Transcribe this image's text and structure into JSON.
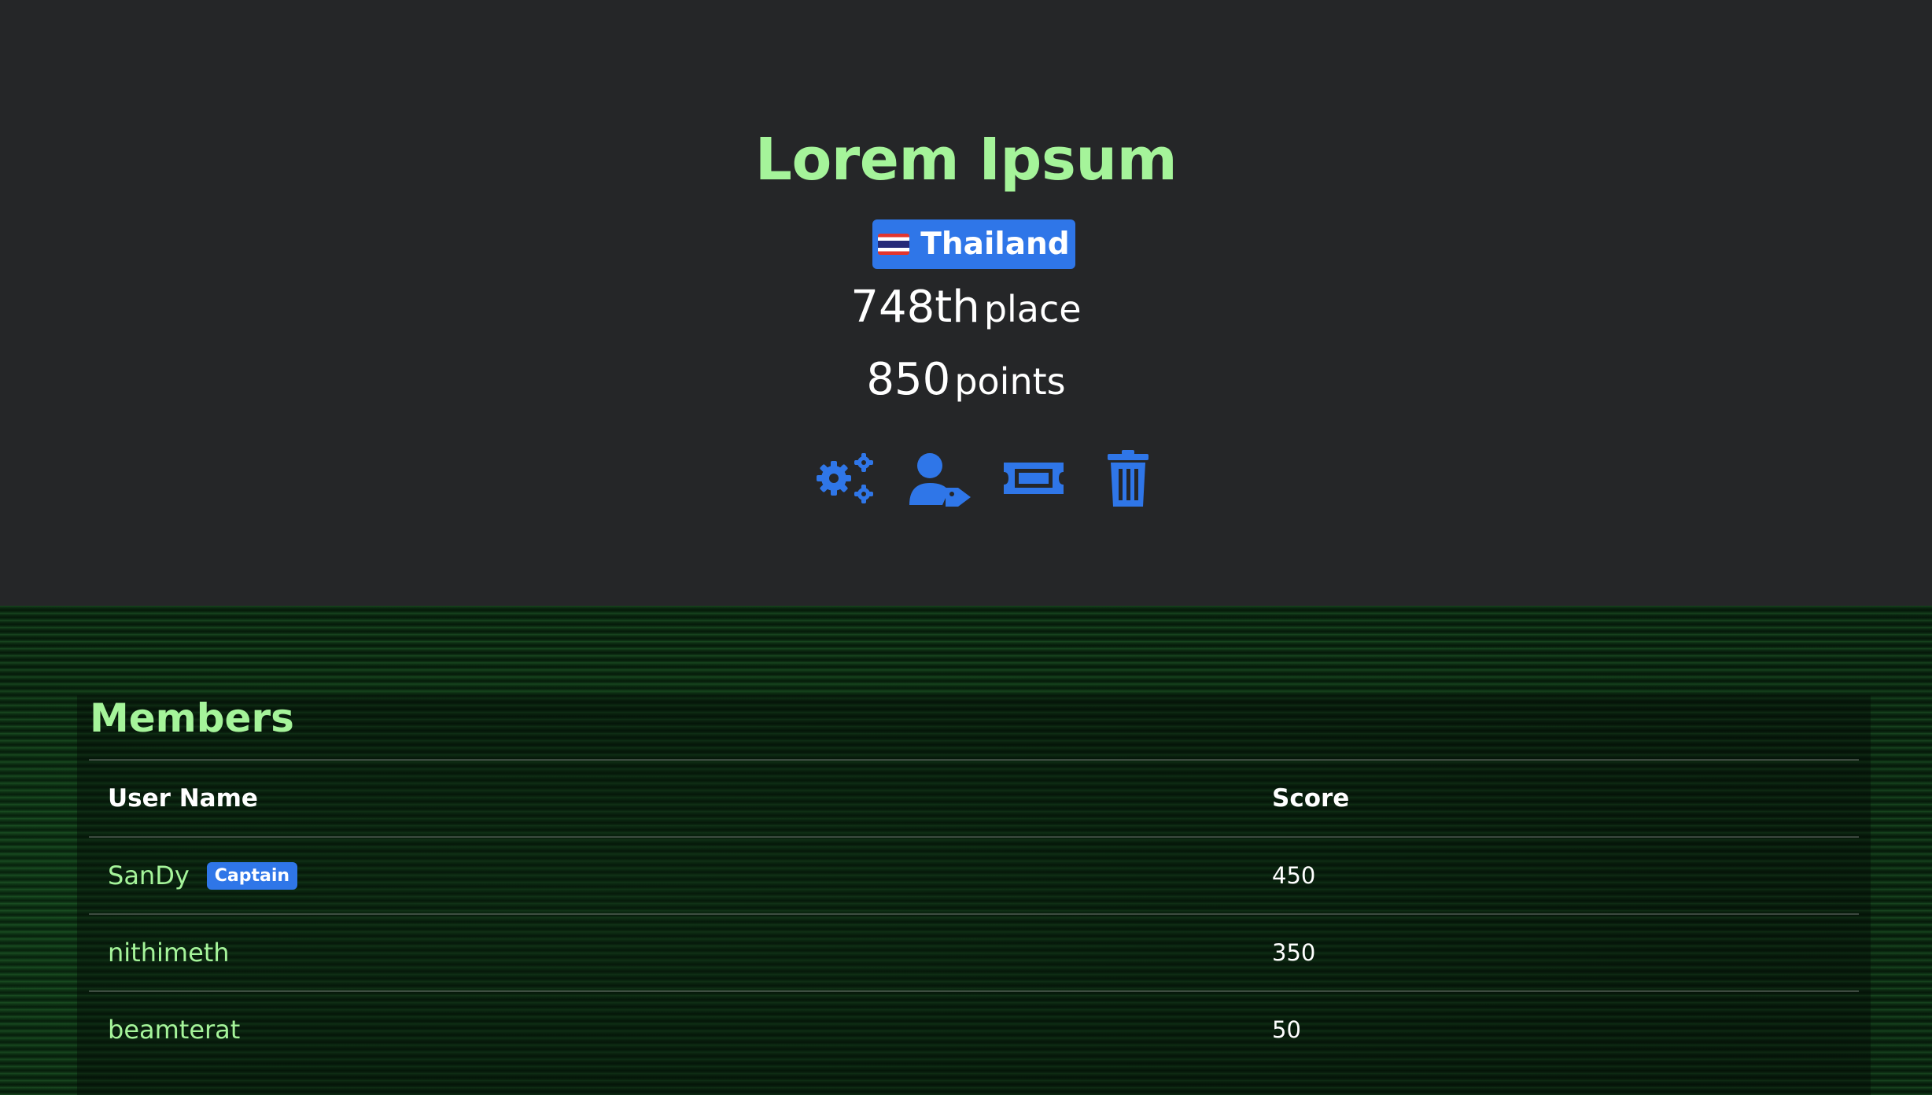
{
  "team": {
    "name": "Lorem Ipsum",
    "country": "Thailand",
    "place_number": "748th",
    "place_label": "place",
    "points_number": "850",
    "points_label": "points"
  },
  "actions": [
    {
      "icon": "gears-icon"
    },
    {
      "icon": "user-tag-icon"
    },
    {
      "icon": "ticket-icon"
    },
    {
      "icon": "trash-icon"
    }
  ],
  "members": {
    "title": "Members",
    "columns": [
      "User Name",
      "Score"
    ],
    "rows": [
      {
        "name": "SanDy",
        "badge": "Captain",
        "score": "450"
      },
      {
        "name": "nithimeth",
        "badge": "",
        "score": "350"
      },
      {
        "name": "beamterat",
        "badge": "",
        "score": "50"
      }
    ]
  },
  "colors": {
    "accent_blue": "#2f76e8",
    "title_green": "#a5f49a",
    "hero_bg": "#252628"
  }
}
